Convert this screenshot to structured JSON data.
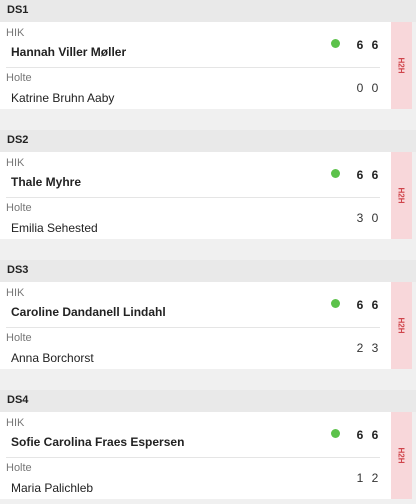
{
  "matches": [
    {
      "title": "DS1",
      "home": {
        "team": "HIK",
        "player": "Hannah Viller Møller",
        "scores": [
          "6",
          "6"
        ]
      },
      "away": {
        "team": "Holte",
        "player": "Katrine Bruhn Aaby",
        "scores": [
          "0",
          "0"
        ]
      },
      "h2h_label": "H2H"
    },
    {
      "title": "DS2",
      "home": {
        "team": "HIK",
        "player": "Thale Myhre",
        "scores": [
          "6",
          "6"
        ]
      },
      "away": {
        "team": "Holte",
        "player": "Emilia Sehested",
        "scores": [
          "3",
          "0"
        ]
      },
      "h2h_label": "H2H"
    },
    {
      "title": "DS3",
      "home": {
        "team": "HIK",
        "player": "Caroline Dandanell Lindahl",
        "scores": [
          "6",
          "6"
        ]
      },
      "away": {
        "team": "Holte",
        "player": "Anna Borchorst",
        "scores": [
          "2",
          "3"
        ]
      },
      "h2h_label": "H2H"
    },
    {
      "title": "DS4",
      "home": {
        "team": "HIK",
        "player": "Sofie Carolina Fraes Espersen",
        "scores": [
          "6",
          "6"
        ]
      },
      "away": {
        "team": "Holte",
        "player": "Maria Palichleb",
        "scores": [
          "1",
          "2"
        ]
      },
      "h2h_label": "H2H"
    }
  ],
  "colors": {
    "winner_dot": "#5cc24a",
    "h2h_bg": "#f8d7da",
    "h2h_text": "#d0454c"
  }
}
